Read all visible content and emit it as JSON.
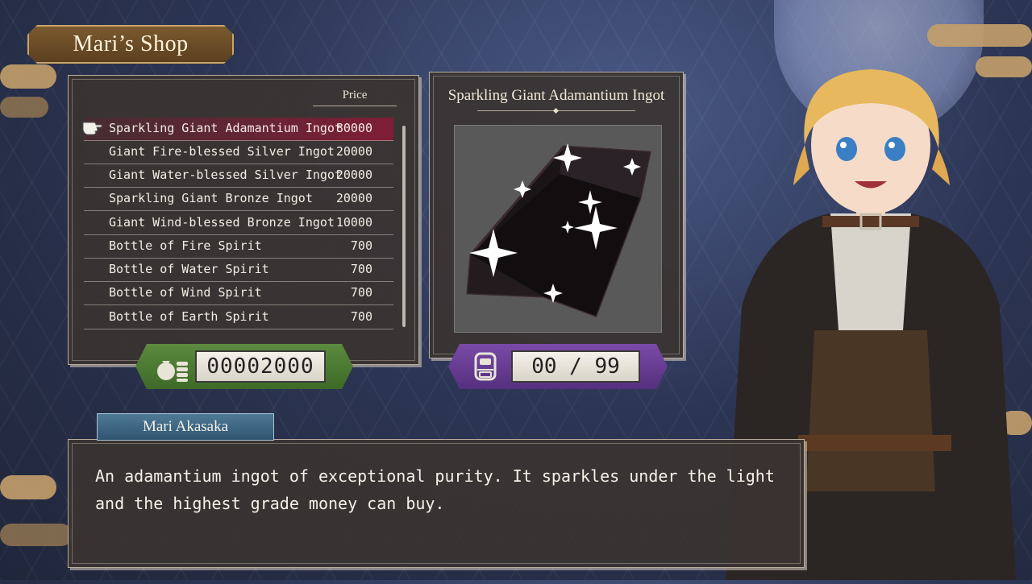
{
  "shop": {
    "title": "Mari’s Shop"
  },
  "list": {
    "price_header": "Price",
    "items": [
      {
        "name": "Sparkling Giant Adamantium Ingot",
        "price": "80000",
        "selected": true
      },
      {
        "name": "Giant Fire-blessed Silver Ingot",
        "price": "20000"
      },
      {
        "name": "Giant Water-blessed Silver Ingot",
        "price": "20000"
      },
      {
        "name": "Sparkling Giant Bronze Ingot",
        "price": "20000"
      },
      {
        "name": "Giant Wind-blessed Bronze Ingot",
        "price": "10000"
      },
      {
        "name": "Bottle of Fire Spirit",
        "price": "700"
      },
      {
        "name": "Bottle of Water Spirit",
        "price": "700"
      },
      {
        "name": "Bottle of Wind Spirit",
        "price": "700"
      },
      {
        "name": "Bottle of Earth Spirit",
        "price": "700"
      }
    ]
  },
  "detail": {
    "item_name": "Sparkling Giant Adamantium Ingot"
  },
  "money": {
    "value": "00002000",
    "icon": "money-bag-icon"
  },
  "inventory": {
    "value": "00 / 99",
    "icon": "backpack-icon"
  },
  "dialogue": {
    "speaker": "Mari Akasaka",
    "text": "An adamantium ingot of exceptional purity. It sparkles under the light\nand the highest grade money can buy."
  },
  "colors": {
    "selected_row": "#8c1937",
    "gold_plate": "#4f7a34",
    "bag_plate": "#6a3f96",
    "speaker_tab": "#3f6683"
  }
}
